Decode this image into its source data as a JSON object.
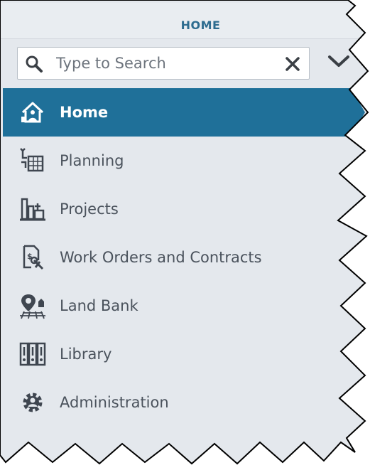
{
  "header": {
    "title": "HOME"
  },
  "search": {
    "placeholder": "Type to Search",
    "value": ""
  },
  "nav": {
    "items": [
      {
        "label": "Home",
        "icon": "home-icon",
        "active": true
      },
      {
        "label": "Planning",
        "icon": "planning-icon",
        "active": false
      },
      {
        "label": "Projects",
        "icon": "projects-icon",
        "active": false
      },
      {
        "label": "Work Orders and Contracts",
        "icon": "work-orders-icon",
        "active": false
      },
      {
        "label": "Land Bank",
        "icon": "land-bank-icon",
        "active": false
      },
      {
        "label": "Library",
        "icon": "library-icon",
        "active": false
      },
      {
        "label": "Administration",
        "icon": "administration-icon",
        "active": false
      }
    ]
  },
  "colors": {
    "accent": "#1f7099",
    "header_text": "#2d6c8f",
    "panel_bg": "#e4e8ed",
    "text": "#4a525c"
  }
}
